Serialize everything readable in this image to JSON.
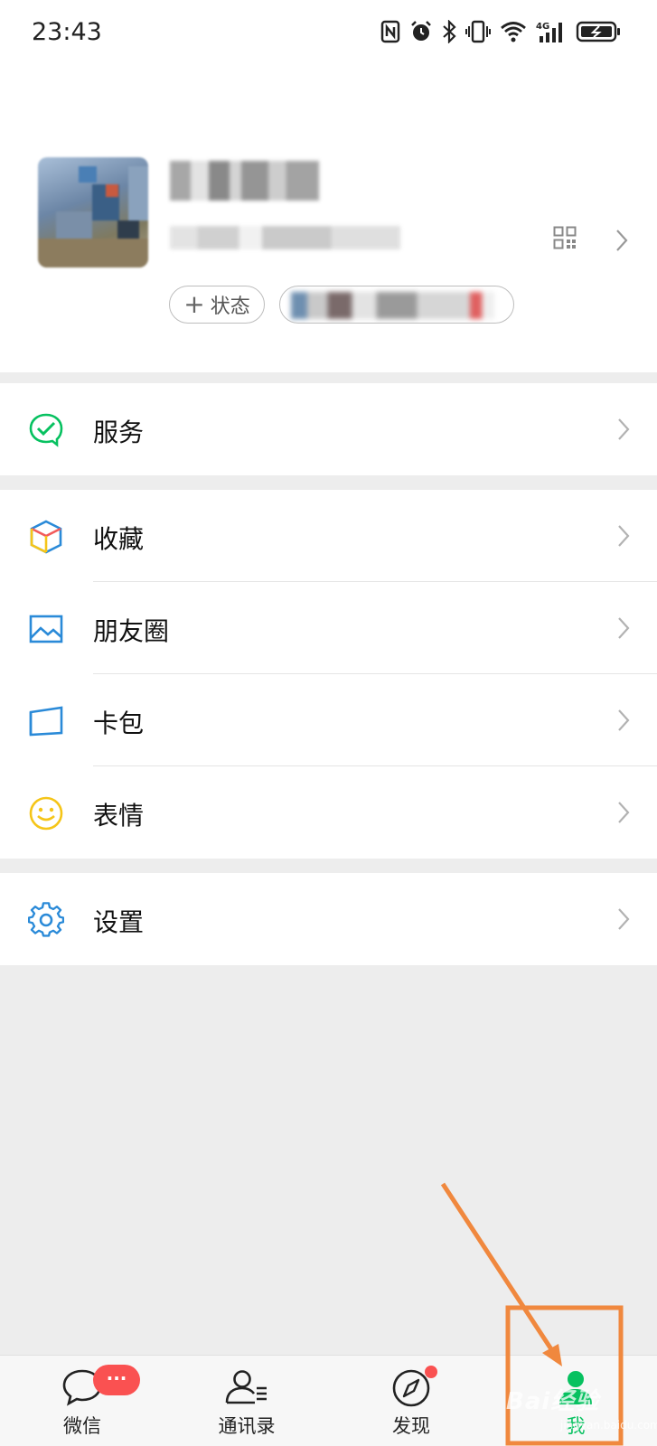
{
  "status_bar": {
    "time": "23:43",
    "icons": [
      "nfc-icon",
      "alarm-icon",
      "bluetooth-icon",
      "vibrate-icon",
      "wifi-icon",
      "signal-4g-icon",
      "battery-charging-icon"
    ],
    "network_label": "4G"
  },
  "profile": {
    "status_button_label": "状态",
    "status_button_icon": "plus-icon"
  },
  "menu": {
    "services": {
      "label": "服务",
      "icon": "wechat-pay-icon",
      "color": "#07c160"
    },
    "favorites": {
      "label": "收藏",
      "icon": "cube-icon"
    },
    "moments": {
      "label": "朋友圈",
      "icon": "image-icon",
      "color": "#2a8ad8"
    },
    "cards": {
      "label": "卡包",
      "icon": "card-icon",
      "color": "#2a8ad8"
    },
    "stickers": {
      "label": "表情",
      "icon": "smiley-icon",
      "color": "#f5c518"
    },
    "settings": {
      "label": "设置",
      "icon": "gear-icon",
      "color": "#2a8ad8"
    }
  },
  "bottom_nav": {
    "tabs": [
      {
        "label": "微信",
        "icon": "chat-bubble-icon",
        "badge": "···"
      },
      {
        "label": "通讯录",
        "icon": "contacts-icon"
      },
      {
        "label": "发现",
        "icon": "compass-icon"
      },
      {
        "label": "我",
        "icon": "person-icon",
        "active": true
      }
    ]
  },
  "annotation": {
    "highlight_color": "#f0883e",
    "watermark": "Bai经验",
    "watermark_sub": "jingyan.baidu.com"
  }
}
